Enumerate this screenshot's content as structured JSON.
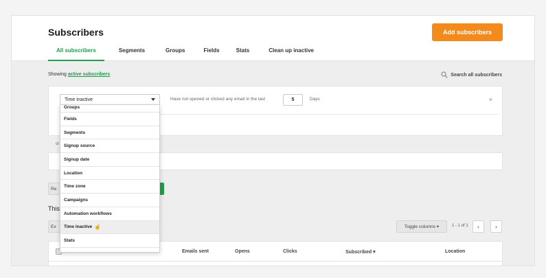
{
  "header": {
    "title": "Subscribers",
    "add_button": "Add subscribers",
    "tabs": [
      "All subscribers",
      "Segments",
      "Groups",
      "Fields",
      "Stats",
      "Clean up inactive"
    ],
    "active_tab": "All subscribers",
    "accent_color": "#1f9d4c",
    "button_color": "#f28a1c"
  },
  "status": {
    "showing_prefix": "Showing",
    "showing_link": "active subscribers",
    "search_all": "Search all subscribers",
    "search_icon": "search-icon"
  },
  "filter": {
    "selected": "Time inactive",
    "condition": "Have not opened or clicked any email in the last",
    "days_value": "5",
    "days_label": "Days",
    "close": "×",
    "or_label": "or",
    "options": [
      "Groups",
      "Fields",
      "Segments",
      "Signup source",
      "Signup date",
      "Location",
      "Time zone",
      "Campaigns",
      "Automation workflows",
      "Time inactive",
      "Stats"
    ],
    "hovered_option": "Time inactive"
  },
  "actions": {
    "reset_partial": "Re",
    "this_partial": "This",
    "export_partial": "Ex",
    "toggle_columns": "Toggle columns ▾",
    "paging": "1 - 1 of 1",
    "prev": "‹",
    "next": "›"
  },
  "table": {
    "columns": [
      "Emails sent",
      "Opens",
      "Clicks",
      "Subscribed ▾",
      "Location"
    ]
  }
}
